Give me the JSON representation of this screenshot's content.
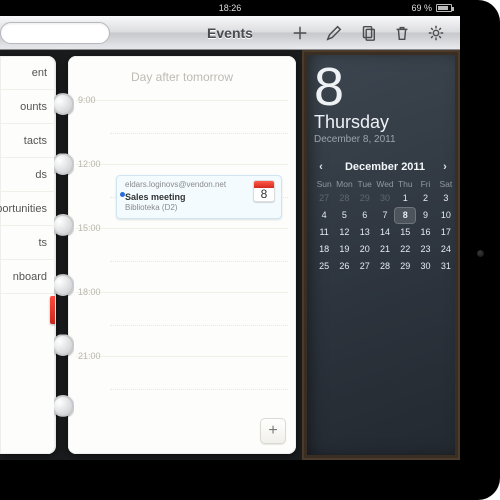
{
  "status": {
    "time": "18:26",
    "battery": "69 %"
  },
  "title": "Events",
  "toolbar": {
    "search_placeholder": ""
  },
  "sidebar": {
    "items": [
      {
        "label": "ent"
      },
      {
        "label": "ounts"
      },
      {
        "label": "tacts"
      },
      {
        "label": "ds"
      },
      {
        "label": "portunities"
      },
      {
        "label": "ts"
      },
      {
        "label": "nboard"
      }
    ]
  },
  "planner": {
    "day_heading": "Day after tomorrow",
    "hours": [
      "9:00",
      "12:00",
      "15:00",
      "18:00",
      "21:00"
    ],
    "event": {
      "from": "eldars.loginovs@vendon.net",
      "title": "Sales meeting",
      "location": "Biblioteka (D2)",
      "icon_day": "8"
    },
    "add_label": "+"
  },
  "date_panel": {
    "big_day": "8",
    "weekday": "Thursday",
    "full": "December 8, 2011"
  },
  "mini_cal": {
    "title": "December 2011",
    "prev": "‹",
    "next": "›",
    "dow": [
      "Sun",
      "Mon",
      "Tue",
      "Wed",
      "Thu",
      "Fri",
      "Sat"
    ],
    "days": [
      {
        "n": 27,
        "other": true
      },
      {
        "n": 28,
        "other": true
      },
      {
        "n": 29,
        "other": true
      },
      {
        "n": 30,
        "other": true
      },
      {
        "n": 1
      },
      {
        "n": 2
      },
      {
        "n": 3
      },
      {
        "n": 4
      },
      {
        "n": 5
      },
      {
        "n": 6
      },
      {
        "n": 7
      },
      {
        "n": 8,
        "today": true
      },
      {
        "n": 9
      },
      {
        "n": 10
      },
      {
        "n": 11
      },
      {
        "n": 12
      },
      {
        "n": 13
      },
      {
        "n": 14
      },
      {
        "n": 15
      },
      {
        "n": 16
      },
      {
        "n": 17
      },
      {
        "n": 18
      },
      {
        "n": 19
      },
      {
        "n": 20
      },
      {
        "n": 21
      },
      {
        "n": 22
      },
      {
        "n": 23
      },
      {
        "n": 24
      },
      {
        "n": 25
      },
      {
        "n": 26
      },
      {
        "n": 27
      },
      {
        "n": 28
      },
      {
        "n": 29
      },
      {
        "n": 30
      },
      {
        "n": 31
      }
    ]
  }
}
